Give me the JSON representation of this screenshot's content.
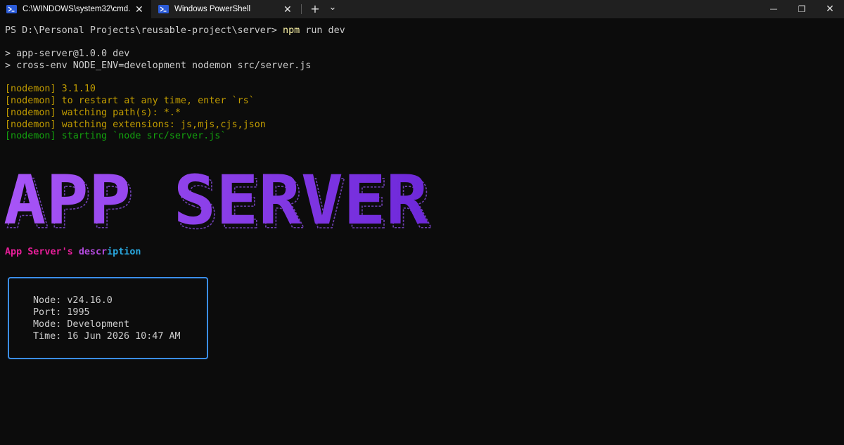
{
  "tabs": [
    {
      "title": "C:\\WINDOWS\\system32\\cmd.",
      "icon": "powershell-icon",
      "active": true,
      "close_label": "✕"
    },
    {
      "title": "Windows PowerShell",
      "icon": "powershell-icon",
      "active": false,
      "close_label": "✕"
    }
  ],
  "titlebar": {
    "new_tab_label": "+",
    "dropdown_label": "⌄",
    "minimize_label": "—",
    "restore_label": "❐",
    "close_label": "✕"
  },
  "terminal": {
    "prompt": "PS D:\\Personal Projects\\reusable-project\\server> ",
    "command_name": "npm",
    "command_args": " run dev",
    "npm_lines": [
      "> app-server@1.0.0 dev",
      "> cross-env NODE_ENV=development nodemon src/server.js"
    ],
    "nodemon_lines": [
      {
        "prefix": "[nodemon]",
        "text": " 3.1.10",
        "color": "#c19c00"
      },
      {
        "prefix": "[nodemon]",
        "text": " to restart at any time, enter `rs`",
        "color": "#c19c00"
      },
      {
        "prefix": "[nodemon]",
        "text": " watching path(s): *.*",
        "color": "#c19c00"
      },
      {
        "prefix": "[nodemon]",
        "text": " watching extensions: js,mjs,cjs,json",
        "color": "#c19c00"
      },
      {
        "prefix": "[nodemon]",
        "text": " starting `node src/server.js`",
        "color": "#13a10e"
      }
    ],
    "banner": {
      "text": "APP SERVER",
      "color_start": "#a855f7",
      "color_end": "#6d28d9"
    },
    "description": {
      "part1": "App Server's ",
      "part2": "descr",
      "part3": "iption",
      "colors": [
        "#e91e9a",
        "#b44adf",
        "#29a8e0"
      ]
    },
    "info": {
      "node": "Node: v24.16.0",
      "port": "Port: 1995",
      "mode": "Mode: Development",
      "time": "Time: 16 Jun 2026 10:47 AM",
      "border_color": "#3b8eea"
    }
  }
}
